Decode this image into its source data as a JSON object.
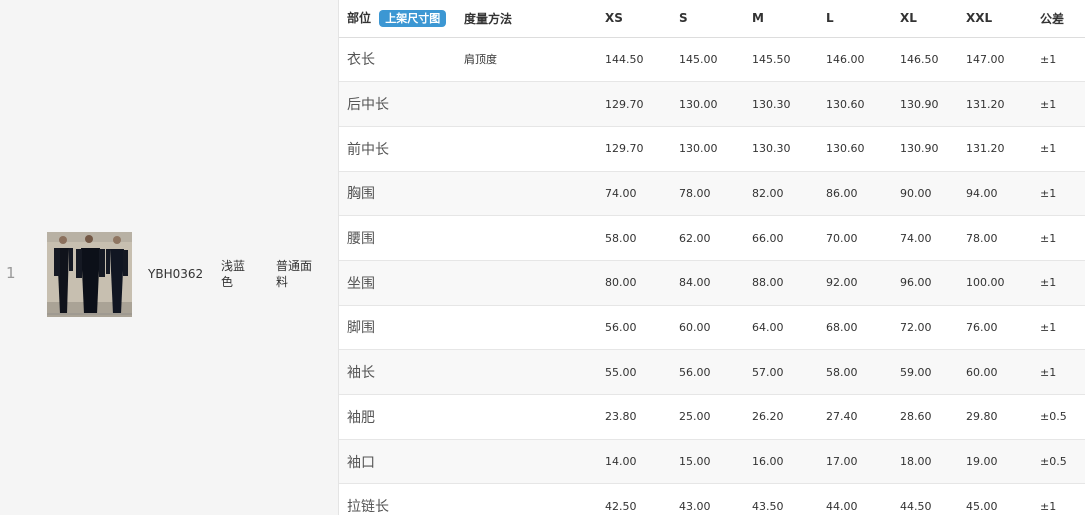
{
  "row": {
    "index": "1",
    "sku": "YBH0362",
    "color": "浅蓝色",
    "fabric": "普通面料"
  },
  "size_table": {
    "headers": {
      "part": "部位",
      "badge": "上架尺寸图",
      "method": "度量方法",
      "xs": "XS",
      "s": "S",
      "m": "M",
      "l": "L",
      "xl": "XL",
      "xxl": "XXL",
      "tolerance": "公差"
    },
    "rows": [
      {
        "part": "衣长",
        "method": "肩顶度",
        "xs": "144.50",
        "s": "145.00",
        "m": "145.50",
        "l": "146.00",
        "xl": "146.50",
        "xxl": "147.00",
        "tolerance": "±1"
      },
      {
        "part": "后中长",
        "method": "",
        "xs": "129.70",
        "s": "130.00",
        "m": "130.30",
        "l": "130.60",
        "xl": "130.90",
        "xxl": "131.20",
        "tolerance": "±1"
      },
      {
        "part": "前中长",
        "method": "",
        "xs": "129.70",
        "s": "130.00",
        "m": "130.30",
        "l": "130.60",
        "xl": "130.90",
        "xxl": "131.20",
        "tolerance": "±1"
      },
      {
        "part": "胸围",
        "method": "",
        "xs": "74.00",
        "s": "78.00",
        "m": "82.00",
        "l": "86.00",
        "xl": "90.00",
        "xxl": "94.00",
        "tolerance": "±1"
      },
      {
        "part": "腰围",
        "method": "",
        "xs": "58.00",
        "s": "62.00",
        "m": "66.00",
        "l": "70.00",
        "xl": "74.00",
        "xxl": "78.00",
        "tolerance": "±1"
      },
      {
        "part": "坐围",
        "method": "",
        "xs": "80.00",
        "s": "84.00",
        "m": "88.00",
        "l": "92.00",
        "xl": "96.00",
        "xxl": "100.00",
        "tolerance": "±1"
      },
      {
        "part": "脚围",
        "method": "",
        "xs": "56.00",
        "s": "60.00",
        "m": "64.00",
        "l": "68.00",
        "xl": "72.00",
        "xxl": "76.00",
        "tolerance": "±1"
      },
      {
        "part": "袖长",
        "method": "",
        "xs": "55.00",
        "s": "56.00",
        "m": "57.00",
        "l": "58.00",
        "xl": "59.00",
        "xxl": "60.00",
        "tolerance": "±1"
      },
      {
        "part": "袖肥",
        "method": "",
        "xs": "23.80",
        "s": "25.00",
        "m": "26.20",
        "l": "27.40",
        "xl": "28.60",
        "xxl": "29.80",
        "tolerance": "±0.5"
      },
      {
        "part": "袖口",
        "method": "",
        "xs": "14.00",
        "s": "15.00",
        "m": "16.00",
        "l": "17.00",
        "xl": "18.00",
        "xxl": "19.00",
        "tolerance": "±0.5"
      },
      {
        "part": "拉链长",
        "method": "",
        "xs": "42.50",
        "s": "43.00",
        "m": "43.50",
        "l": "44.00",
        "xl": "44.50",
        "xxl": "45.00",
        "tolerance": "±1"
      }
    ]
  }
}
